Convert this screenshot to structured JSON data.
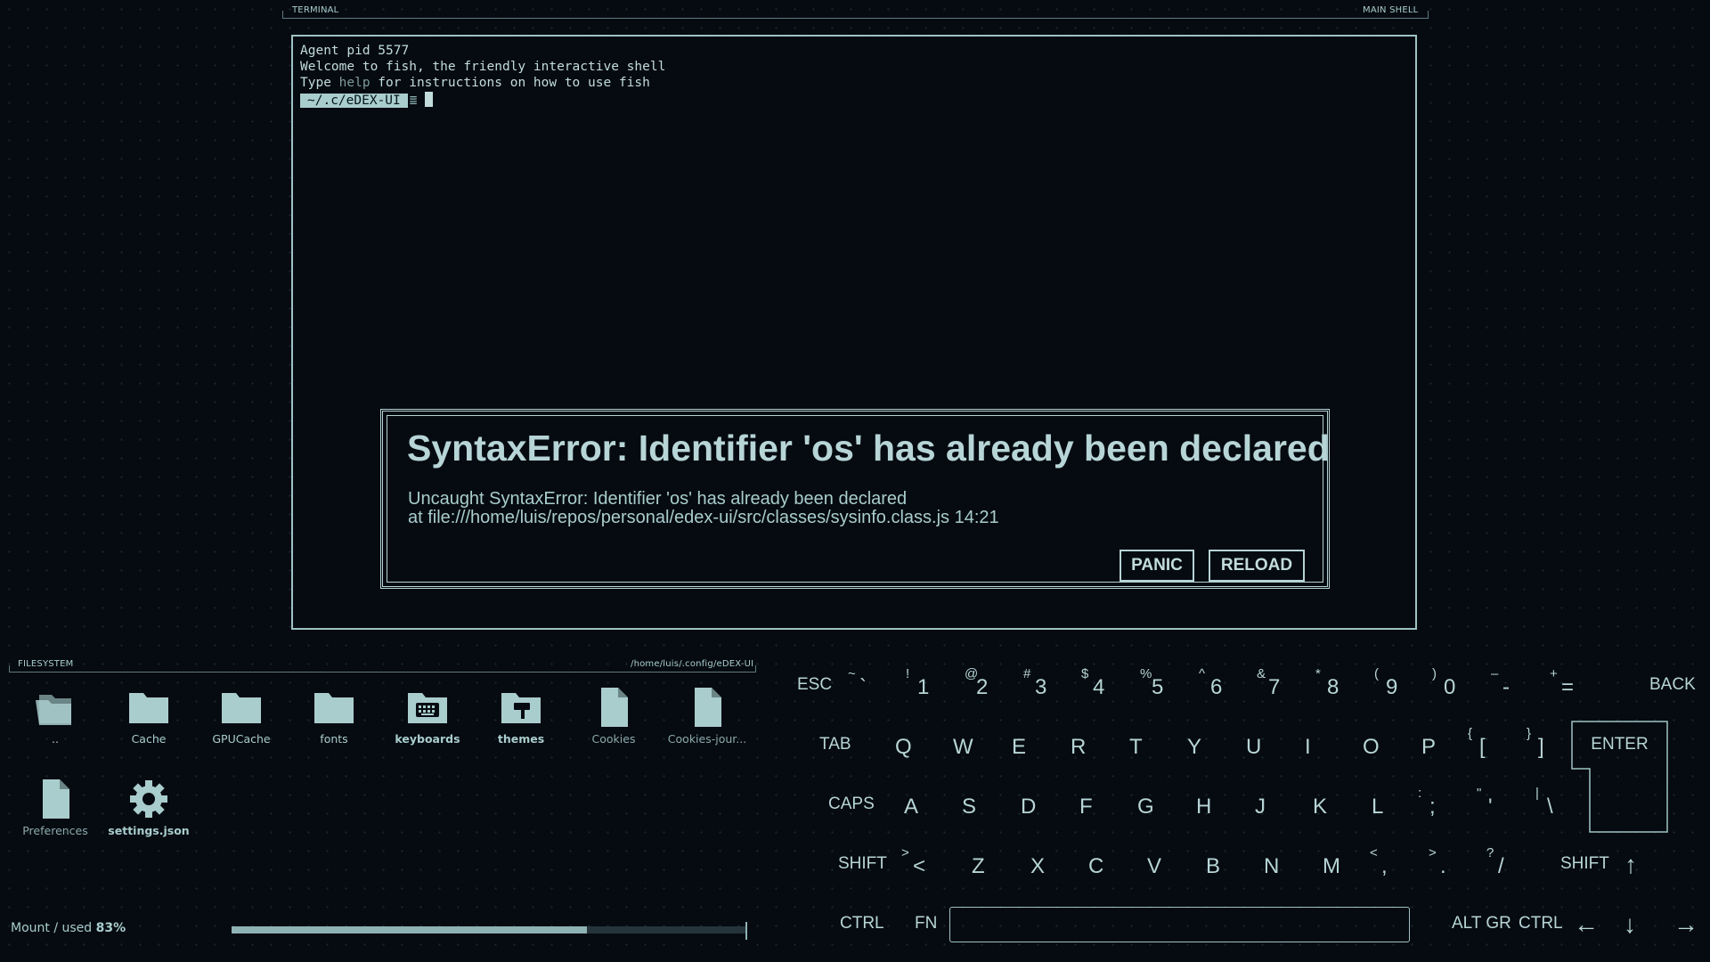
{
  "terminal": {
    "header_left": "TERMINAL",
    "header_right": "MAIN SHELL",
    "lines": [
      "Agent pid 5577",
      "Welcome to fish, the friendly interactive shell"
    ],
    "help_line_pre": "Type ",
    "help_line_word": "help",
    "help_line_post": " for instructions on how to use fish",
    "prompt": "~/.c/eDEX-UI",
    "prompt_glyph": "≣"
  },
  "error_dialog": {
    "title": "SyntaxError: Identifier 'os' has already been declared",
    "message_line1": "Uncaught SyntaxError: Identifier 'os' has already been declared",
    "message_line2": "at file:///home/luis/repos/personal/edex-ui/src/classes/sysinfo.class.js 14:21",
    "panic_label": "PANIC",
    "reload_label": "RELOAD"
  },
  "filesystem": {
    "header_left": "FILESYSTEM",
    "header_right": "/home/luis/.config/eDEX-UI",
    "items": [
      {
        "label": "..",
        "icon": "parent-folder-icon"
      },
      {
        "label": "Cache",
        "icon": "folder-icon"
      },
      {
        "label": "GPUCache",
        "icon": "folder-icon"
      },
      {
        "label": "fonts",
        "icon": "folder-icon"
      },
      {
        "label": "keyboards",
        "icon": "keyboard-folder-icon"
      },
      {
        "label": "themes",
        "icon": "themes-folder-icon"
      },
      {
        "label": "Cookies",
        "icon": "file-icon"
      },
      {
        "label": "Cookies-jour...",
        "icon": "file-icon"
      },
      {
        "label": "Preferences",
        "icon": "file-icon"
      },
      {
        "label": "settings.json",
        "icon": "settings-gear-icon"
      }
    ]
  },
  "mount": {
    "label": "Mount",
    "sep": " / ",
    "used_label": "used",
    "percent_text": "83%",
    "used_fraction": 0.69
  },
  "keyboard": {
    "row1": [
      {
        "main": "ESC"
      },
      {
        "main": "`",
        "shift": "~"
      },
      {
        "main": "1",
        "shift": "!"
      },
      {
        "main": "2",
        "shift": "@"
      },
      {
        "main": "3",
        "shift": "#"
      },
      {
        "main": "4",
        "shift": "$"
      },
      {
        "main": "5",
        "shift": "%"
      },
      {
        "main": "6",
        "shift": "^"
      },
      {
        "main": "7",
        "shift": "&"
      },
      {
        "main": "8",
        "shift": "*"
      },
      {
        "main": "9",
        "shift": "("
      },
      {
        "main": "0",
        "shift": ")"
      },
      {
        "main": "-",
        "shift": "–"
      },
      {
        "main": "=",
        "shift": "+"
      },
      {
        "main": "BACK"
      }
    ],
    "row2": [
      {
        "main": "TAB"
      },
      {
        "main": "Q"
      },
      {
        "main": "W"
      },
      {
        "main": "E"
      },
      {
        "main": "R"
      },
      {
        "main": "T"
      },
      {
        "main": "Y"
      },
      {
        "main": "U"
      },
      {
        "main": "I"
      },
      {
        "main": "O"
      },
      {
        "main": "P"
      },
      {
        "main": "[",
        "shift": "{"
      },
      {
        "main": "]",
        "shift": "}"
      }
    ],
    "enter": "ENTER",
    "row3": [
      {
        "main": "CAPS"
      },
      {
        "main": "A"
      },
      {
        "main": "S"
      },
      {
        "main": "D"
      },
      {
        "main": "F"
      },
      {
        "main": "G"
      },
      {
        "main": "H"
      },
      {
        "main": "J"
      },
      {
        "main": "K"
      },
      {
        "main": "L"
      },
      {
        "main": ";",
        "shift": ":"
      },
      {
        "main": "'",
        "shift": "\""
      },
      {
        "main": "\\",
        "shift": "|"
      }
    ],
    "row4": [
      {
        "main": "SHIFT"
      },
      {
        "main": "<",
        "shift": ">"
      },
      {
        "main": "Z"
      },
      {
        "main": "X"
      },
      {
        "main": "C"
      },
      {
        "main": "V"
      },
      {
        "main": "B"
      },
      {
        "main": "N"
      },
      {
        "main": "M"
      },
      {
        "main": ",",
        "shift": "<"
      },
      {
        "main": ".",
        "shift": ">"
      },
      {
        "main": "/",
        "shift": "?"
      },
      {
        "main": "SHIFT"
      },
      {
        "main": "↑"
      }
    ],
    "row5": [
      {
        "main": "CTRL"
      },
      {
        "main": "FN"
      },
      {
        "main": "ALT GR"
      },
      {
        "main": "CTRL"
      },
      {
        "main": "←"
      },
      {
        "main": "↓"
      },
      {
        "main": "→"
      }
    ]
  },
  "colors": {
    "accent": "#a9cccd",
    "background": "#050b10",
    "border": "#9fc3c4"
  }
}
